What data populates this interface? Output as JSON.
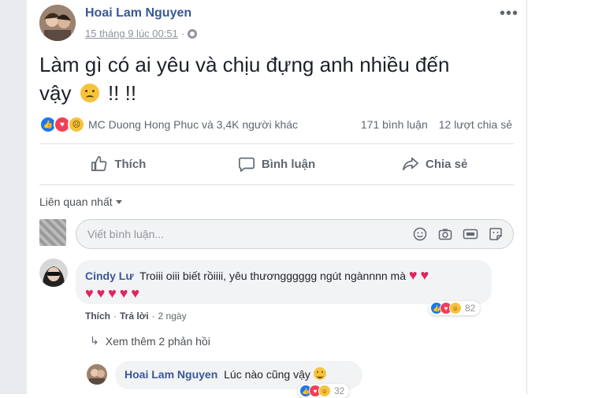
{
  "post": {
    "author": "Hoai Lam Nguyen",
    "timestamp": "15 tháng 9 lúc 00:51",
    "text_line1": "Làm gì có ai yêu và chịu đựng anh nhiều đến",
    "text_line2_start": "vậy",
    "text_line2_end": "!! !!"
  },
  "reactions": {
    "names": "MC Duong Hong Phuc và 3,4K người khác",
    "comments_count": "171 bình luận",
    "shares_count": "12 lượt chia sẻ"
  },
  "actions": {
    "like": "Thích",
    "comment": "Bình luận",
    "share": "Chia sẻ"
  },
  "comments_section": {
    "sort_label": "Liên quan nhất",
    "input_placeholder": "Viết bình luận..."
  },
  "comment1": {
    "author": "Cindy Lư",
    "text": "Troiii oiii biết rồiiii, yêu thươngggggg ngút ngànnnn mà",
    "reaction_count": "82",
    "like_label": "Thích",
    "reply_label": "Trả lời",
    "time": "2 ngày"
  },
  "more_replies": "Xem thêm 2 phản hồi",
  "reply1": {
    "author": "Hoai Lam Nguyen",
    "text": "Lúc nào cũng vậy",
    "reaction_count": "32"
  },
  "colors": {
    "link": "#385898",
    "like": "#1877f2",
    "love": "#f33e58",
    "emoji": "#f7c33b",
    "heart": "#e0245e"
  }
}
